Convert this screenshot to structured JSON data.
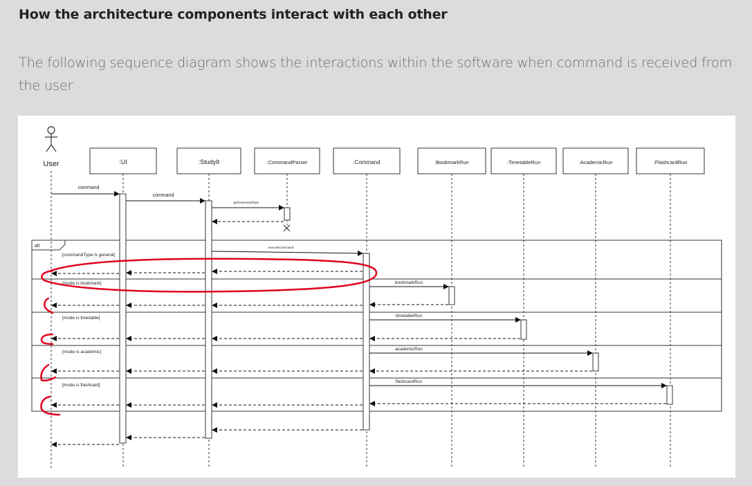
{
  "heading": "How the architecture components interact with each other",
  "description": "The following sequence diagram shows the interactions within the software when command is received from the user",
  "diagram": {
    "actor": "User",
    "participants": [
      ":UI",
      ":StudyIt",
      ":CommandParser",
      ":Command",
      ":BookmarkRun",
      ":TimetableRun",
      ":AcademicRun",
      ":FlashcardRun"
    ],
    "messages": {
      "m1": "command",
      "m2": "command",
      "m3": "getCommandType",
      "m4": "executeCommand",
      "m5": "bookmarkRun",
      "m6": "timetableRun",
      "m7": "academicRun",
      "m8": "flashcardRun"
    },
    "fragment": {
      "label": "alt",
      "guards": [
        "[commandType is general]",
        "[mode is bookmark]",
        "[mode is timetable]",
        "[mode is academic]",
        "[mode is flashcard]"
      ]
    },
    "annotation_color": "#e0001b"
  }
}
